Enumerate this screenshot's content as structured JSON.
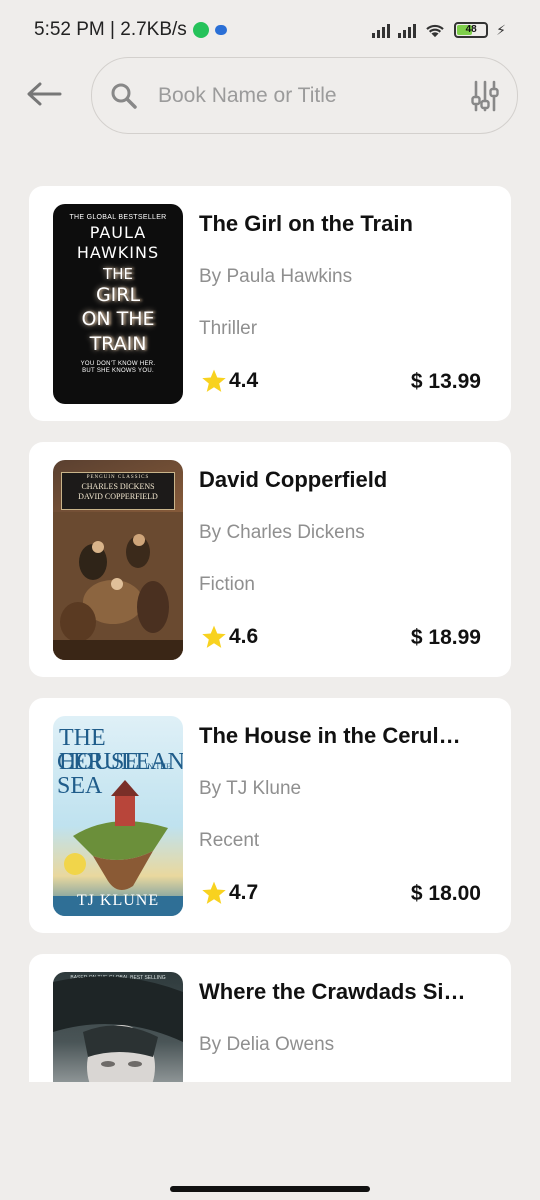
{
  "status_bar": {
    "time_speed": "5:52 PM | 2.7KB/s",
    "battery": "48"
  },
  "search": {
    "placeholder": "Book Name or Title"
  },
  "books": [
    {
      "title": "The Girl on the Train",
      "author": "By Paula Hawkins",
      "genre": "Thriller",
      "rating": "4.4",
      "price": "$ 13.99",
      "cover": {
        "line1": "THE GLOBAL BESTSELLER",
        "line2a": "PAULA",
        "line2b": "HAWKINS",
        "line3a": "THE",
        "line3b": "GIRL",
        "line3c": "ON THE",
        "line3d": "TRAIN",
        "line4a": "YOU DON'T KNOW HER.",
        "line4b": "BUT SHE KNOWS YOU."
      }
    },
    {
      "title": "David Copperfield",
      "author": "By Charles Dickens",
      "genre": "Fiction",
      "rating": "4.6",
      "price": "$ 18.99",
      "cover": {
        "publisher": "PENGUIN CLASSICS",
        "author": "CHARLES DICKENS",
        "title": "DAVID COPPERFIELD"
      }
    },
    {
      "title": "The House in the Cerul…",
      "author": "By TJ Klune",
      "genre": "Recent",
      "rating": "4.7",
      "price": "$ 18.00",
      "cover": {
        "line1": "THE HOUSE",
        "line1_small": "IN THE",
        "line2": "CERULEAN",
        "line3": "SEA",
        "author": "TJ KLUNE"
      }
    },
    {
      "title": "Where the Crawdads Si…",
      "author": "By Delia Owens",
      "cover": {
        "header": "BASED ON THE GLOBAL BEST SELLING PHENOMENON"
      }
    }
  ]
}
